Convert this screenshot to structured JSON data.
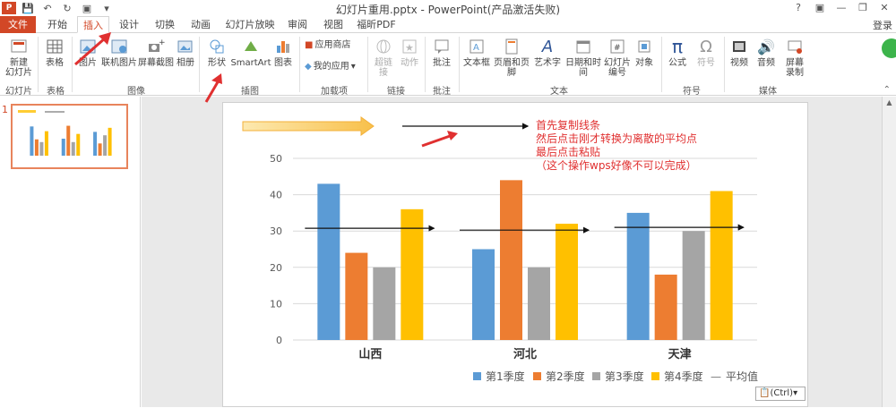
{
  "window": {
    "title": "幻灯片重用.pptx - PowerPoint(产品激活失败)",
    "login_label": "登录"
  },
  "tabs": [
    "文件",
    "开始",
    "插入",
    "设计",
    "切换",
    "动画",
    "幻灯片放映",
    "审阅",
    "视图",
    "福昕PDF"
  ],
  "ribbon": {
    "groups": [
      {
        "label": "幻灯片",
        "buttons": [
          "新建\n幻灯片"
        ]
      },
      {
        "label": "表格",
        "buttons": [
          "表格"
        ]
      },
      {
        "label": "图像",
        "buttons": [
          "图片",
          "联机图片",
          "屏幕截图",
          "相册"
        ]
      },
      {
        "label": "插图",
        "buttons": [
          "形状",
          "SmartArt",
          "图表"
        ]
      },
      {
        "label": "加载项",
        "buttons": [
          "应用商店",
          "我的应用"
        ]
      },
      {
        "label": "链接",
        "buttons": [
          "超链接",
          "动作"
        ]
      },
      {
        "label": "批注",
        "buttons": [
          "批注"
        ]
      },
      {
        "label": "文本",
        "buttons": [
          "文本框",
          "页眉和页脚",
          "艺术字",
          "日期和时间",
          "幻灯片\n编号",
          "对象"
        ]
      },
      {
        "label": "符号",
        "buttons": [
          "公式",
          "符号"
        ]
      },
      {
        "label": "媒体",
        "buttons": [
          "视频",
          "音频",
          "屏幕\n录制"
        ]
      }
    ]
  },
  "thumbnail": {
    "number": "1"
  },
  "annotation": {
    "lines": [
      "首先复制线条",
      "然后点击刚才转换为离散的平均点",
      "最后点击粘贴",
      "（这个操作wps好像不可以完成）"
    ]
  },
  "paste_tag": "(Ctrl)",
  "colors": {
    "accent": "#d24726",
    "q1": "#5b9bd5",
    "q2": "#ed7d31",
    "q3": "#a5a5a5",
    "q4": "#ffc000",
    "annotation": "#e03030"
  },
  "chart_data": {
    "type": "bar",
    "categories": [
      "山西",
      "河北",
      "天津"
    ],
    "series": [
      {
        "name": "第1季度",
        "values": [
          43,
          25,
          35
        ]
      },
      {
        "name": "第2季度",
        "values": [
          24,
          44,
          18
        ]
      },
      {
        "name": "第3季度",
        "values": [
          20,
          20,
          30
        ]
      },
      {
        "name": "第4季度",
        "values": [
          36,
          32,
          41
        ]
      }
    ],
    "average_series": {
      "name": "平均值",
      "values": [
        30.75,
        30.25,
        31
      ]
    },
    "y_ticks": [
      "0",
      "10",
      "20",
      "30",
      "40",
      "50"
    ],
    "ylim": [
      0,
      50
    ],
    "grid": true,
    "legend": "bottom"
  }
}
